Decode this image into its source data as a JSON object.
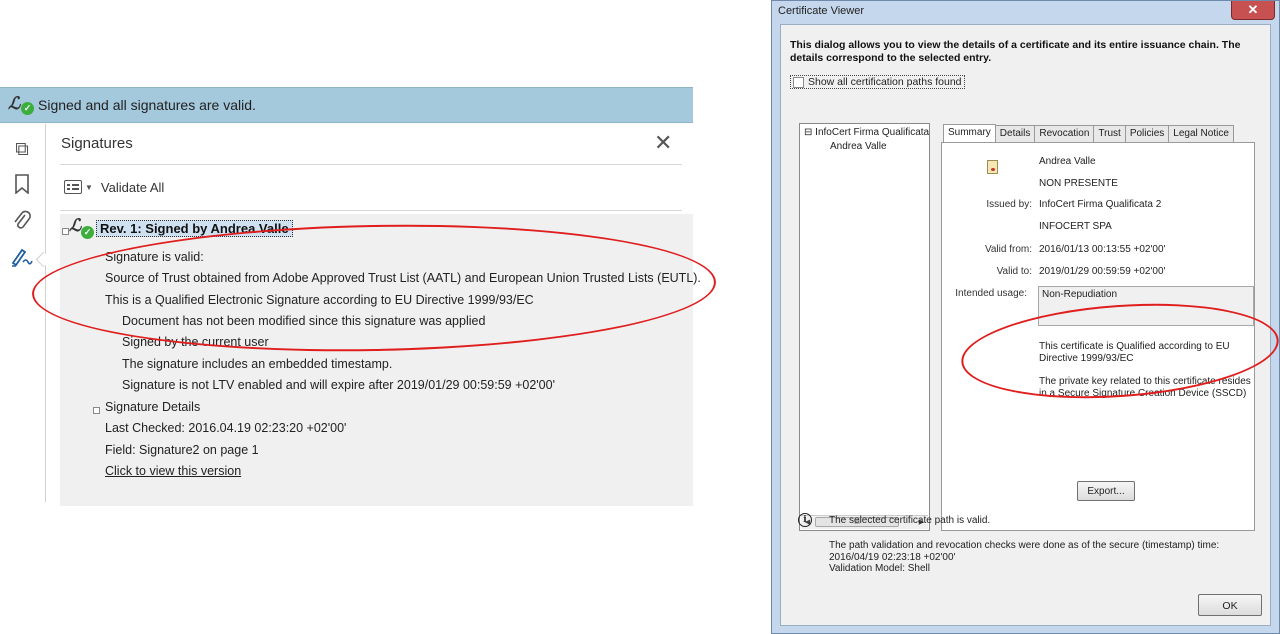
{
  "signature_panel": {
    "banner_text": "Signed and all signatures are valid.",
    "title": "Signatures",
    "close_glyph": "✕",
    "validate_all_label": "Validate All",
    "rail_icons": [
      "pages-icon",
      "bookmark-icon",
      "attachment-icon",
      "signature-icon"
    ],
    "revision_label": "Rev. 1: Signed by Andrea Valle",
    "lines": {
      "signature_valid": "Signature is valid:",
      "source_of_trust": "Source of Trust obtained from Adobe Approved Trust List (AATL) and European Union Trusted Lists (EUTL).",
      "qualified": "This is a Qualified Electronic Signature according to EU Directive 1999/93/EC",
      "not_modified": "Document has not been modified since this signature was applied",
      "signed_by_user": "Signed by the current user",
      "timestamp": "The signature includes an embedded timestamp.",
      "ltv": "Signature is not LTV enabled and will expire after 2019/01/29 00:59:59 +02'00'",
      "details": "Signature Details",
      "last_checked": "Last Checked: 2016.04.19 02:23:20 +02'00'",
      "field": "Field: Signature2 on page 1",
      "view_version": "Click to view this version"
    }
  },
  "certificate_viewer": {
    "window_title": "Certificate Viewer",
    "close_glyph": "✕",
    "intro": "This dialog allows you to view the details of a certificate and its entire issuance chain. The details correspond to the selected entry.",
    "show_all_paths": "Show all certification paths found",
    "chain": {
      "root": "InfoCert Firma Qualificata",
      "child": "Andrea Valle",
      "scroll_mark": "III"
    },
    "tabs": [
      "Summary",
      "Details",
      "Revocation",
      "Trust",
      "Policies",
      "Legal Notice"
    ],
    "active_tab": "Summary",
    "summary": {
      "subject_name": "Andrea Valle",
      "subject_org": "NON PRESENTE",
      "issued_by_label": "Issued by:",
      "issued_by": "InfoCert Firma Qualificata 2",
      "issuer_org": "INFOCERT SPA",
      "valid_from_label": "Valid from:",
      "valid_from": "2016/01/13 00:13:55 +02'00'",
      "valid_to_label": "Valid to:",
      "valid_to": "2019/01/29 00:59:59 +02'00'",
      "intended_usage_label": "Intended usage:",
      "intended_usage": "Non-Repudiation",
      "qualified_note": "This certificate is Qualified according to EU Directive 1999/93/EC",
      "sscd_note": "The private key related to this certificate resides in a Secure Signature Creation Device (SSCD)",
      "export_label": "Export..."
    },
    "path_status": "The selected certificate path is valid.",
    "validation_line1": "The path validation and revocation checks were done as of the secure (timestamp) time:",
    "validation_line2": "2016/04/19 02:23:18 +02'00'",
    "validation_line3": "Validation Model: Shell",
    "ok_label": "OK"
  },
  "colors": {
    "banner_bg": "#a4c8dc",
    "valid_green": "#3cae3c",
    "annotation_red": "#e01e1e",
    "window_frame": "#c5d7ec"
  }
}
